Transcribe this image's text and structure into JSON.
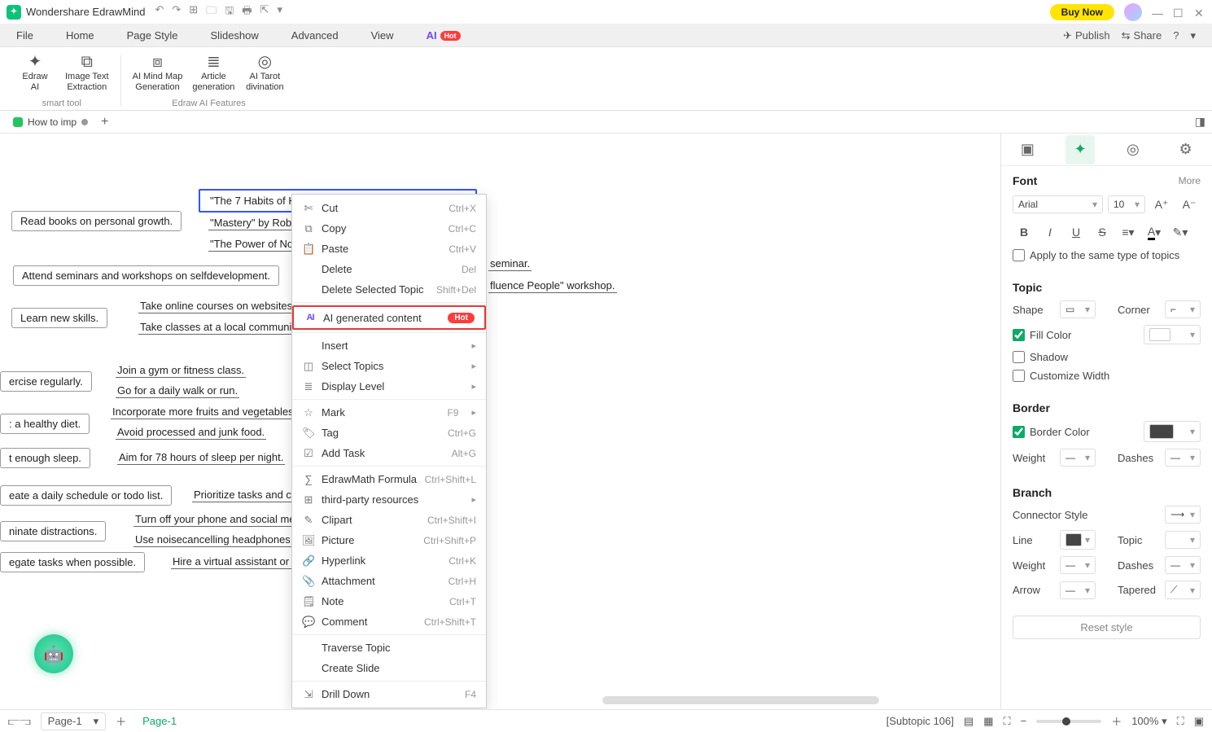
{
  "app": {
    "title": "Wondershare EdrawMind",
    "buy_now": "Buy Now"
  },
  "menu": {
    "items": [
      "File",
      "Home",
      "Page Style",
      "Slideshow",
      "Advanced",
      "View"
    ],
    "ai_label": "AI",
    "ai_badge": "Hot",
    "publish": "Publish",
    "share": "Share"
  },
  "ribbon": {
    "group1_label": "smart tool",
    "group2_label": "Edraw AI Features",
    "btns": {
      "edraw_ai": "Edraw\nAI",
      "image_text": "Image Text\nExtraction",
      "ai_mindmap": "AI Mind Map\nGeneration",
      "article": "Article\ngeneration",
      "tarot": "AI Tarot\ndivination"
    }
  },
  "doc_tab": {
    "name": "How to imp",
    "plus": "+"
  },
  "mindmap": {
    "selected": "\"The 7 Habits of Hi",
    "n2": "\"Mastery\" by Robe",
    "n3": "\"The Power of Now",
    "read_books": "Read books on personal growth.",
    "seminars": "Attend seminars and workshops on selfdevelopment.",
    "learn_skills": "Learn new skills.",
    "online_courses": "Take online courses on websites li",
    "local_classes": "Take classes at a local community",
    "seminar_tail": "seminar.",
    "workshop_tail": "fluence People\" workshop.",
    "exercise": "ercise regularly.",
    "gym": "Join a gym or fitness class.",
    "walk": "Go for a daily walk or run.",
    "healthy_diet": ": a healthy diet.",
    "fruits": "Incorporate more fruits and vegetables i",
    "junk": "Avoid processed and junk food.",
    "sleep": "t enough sleep.",
    "sleep78": "Aim for 78 hours of sleep per night.",
    "schedule": "eate a daily schedule or todo list.",
    "prioritize": "Prioritize tasks and co",
    "distractions": "ninate distractions.",
    "phone_off": "Turn off your phone and social medi",
    "headphones": "Use noisecancelling headphones if",
    "delegate": "egate tasks when possible.",
    "hire_va": "Hire a virtual assistant or as"
  },
  "context_menu": {
    "cut": "Cut",
    "cut_sc": "Ctrl+X",
    "copy": "Copy",
    "copy_sc": "Ctrl+C",
    "paste": "Paste",
    "paste_sc": "Ctrl+V",
    "delete": "Delete",
    "delete_sc": "Del",
    "delete_sel": "Delete Selected Topic",
    "delete_sel_sc": "Shift+Del",
    "ai_gen": "AI generated content",
    "ai_gen_badge": "Hot",
    "insert": "Insert",
    "select_topics": "Select Topics",
    "display_level": "Display Level",
    "mark": "Mark",
    "mark_sc": "F9",
    "tag": "Tag",
    "tag_sc": "Ctrl+G",
    "add_task": "Add Task",
    "add_task_sc": "Alt+G",
    "formula": "EdrawMath Formula",
    "formula_sc": "Ctrl+Shift+L",
    "third_party": "third-party resources",
    "clipart": "Clipart",
    "clipart_sc": "Ctrl+Shift+I",
    "picture": "Picture",
    "picture_sc": "Ctrl+Shift+P",
    "hyperlink": "Hyperlink",
    "hyperlink_sc": "Ctrl+K",
    "attachment": "Attachment",
    "attachment_sc": "Ctrl+H",
    "note": "Note",
    "note_sc": "Ctrl+T",
    "comment": "Comment",
    "comment_sc": "Ctrl+Shift+T",
    "traverse": "Traverse Topic",
    "create_slide": "Create Slide",
    "drill": "Drill Down",
    "drill_sc": "F4"
  },
  "panel": {
    "font_head": "Font",
    "more": "More",
    "font_family": "Arial",
    "font_size": "10",
    "apply_same": "Apply to the same type of topics",
    "topic_head": "Topic",
    "shape": "Shape",
    "corner": "Corner",
    "fill_color": "Fill Color",
    "shadow": "Shadow",
    "custom_width": "Customize Width",
    "border_head": "Border",
    "border_color": "Border Color",
    "weight": "Weight",
    "dashes": "Dashes",
    "branch_head": "Branch",
    "connector": "Connector Style",
    "line": "Line",
    "topic": "Topic",
    "arrow": "Arrow",
    "tapered": "Tapered",
    "reset": "Reset style"
  },
  "status": {
    "page_combo": "Page-1",
    "page_tab": "Page-1",
    "subtopic": "[Subtopic 106]",
    "zoom": "100%"
  }
}
